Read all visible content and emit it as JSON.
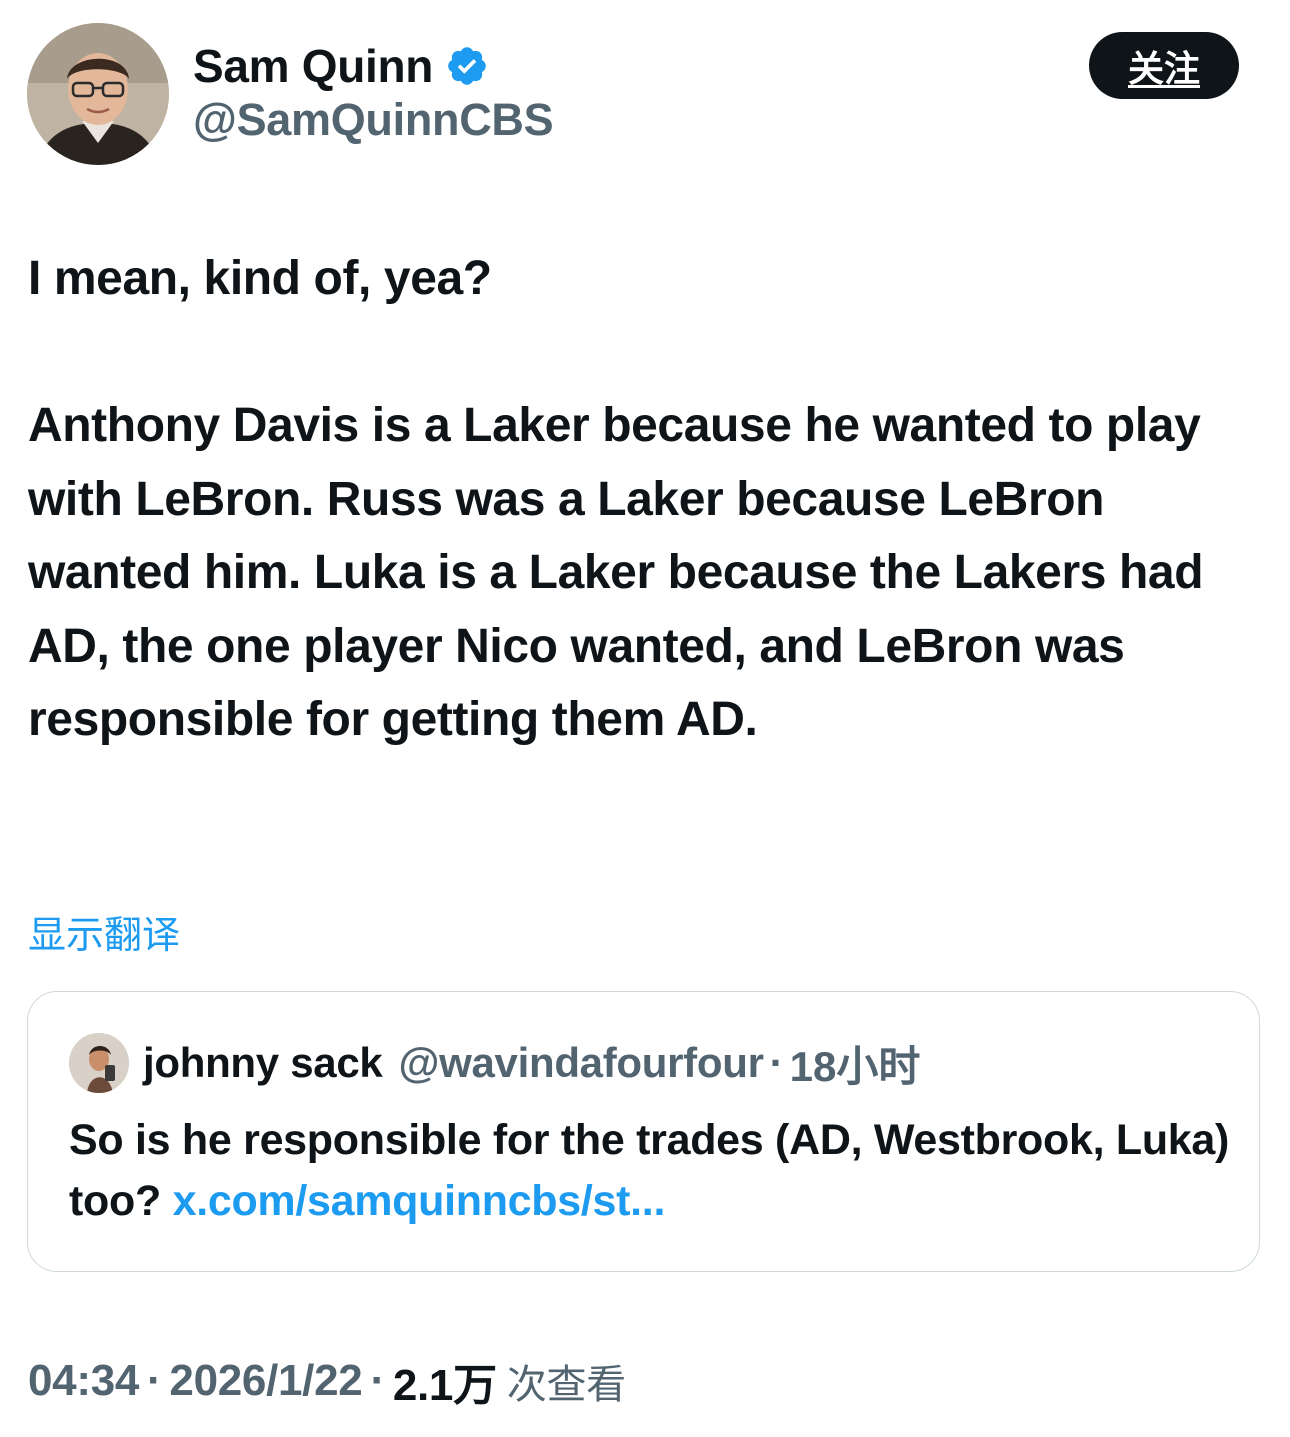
{
  "author": {
    "display_name": "Sam Quinn",
    "handle": "@SamQuinnCBS",
    "verified": true,
    "avatar_icon": "avatar-photo-icon"
  },
  "follow_button": {
    "label": "关注"
  },
  "tweet": {
    "paragraph_1": "I mean, kind of, yea?",
    "paragraph_2": "Anthony Davis is a Laker because he wanted to play with LeBron. Russ was a Laker because LeBron wanted him. Luka is a Laker because the Lakers had AD, the one player Nico wanted, and LeBron was responsible for getting them AD.",
    "translate_label": "显示翻译"
  },
  "quoted_tweet": {
    "display_name": "johnny sack",
    "handle": "@wavindafourfour",
    "separator": "·",
    "time": "18小时",
    "text": "So is he responsible for the trades (AD, Westbrook, Luka) too? ",
    "link_text": "x.com/samquinncbs/st..."
  },
  "meta": {
    "time": "04:34",
    "separator": "·",
    "date": "2026/1/22",
    "views_count": "2.1万",
    "views_label": "次查看"
  },
  "colors": {
    "text_primary": "#0f1419",
    "text_secondary": "#536471",
    "accent_blue": "#1d9bf0",
    "border": "#cfd9de"
  }
}
